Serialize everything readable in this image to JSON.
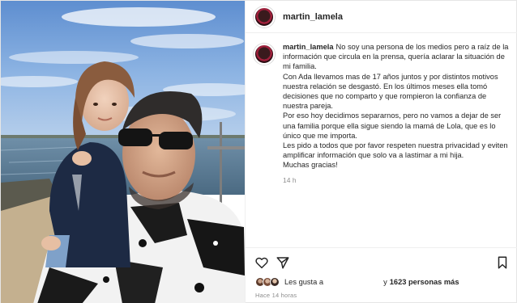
{
  "post": {
    "username": "martin_lamela",
    "caption": {
      "paragraphs": [
        "No soy una persona de los medios pero a raíz de la información que circula en la prensa, quería aclarar la situación de mi familia.",
        "Con Ada llevamos mas de 17 años juntos y por distintos motivos nuestra relación se desgastó. En los últimos meses ella tomó decisiones que no comparto y que rompieron la confianza de nuestra pareja.",
        "Por eso hoy decidimos separarnos, pero no vamos a dejar de ser una familia porque ella sigue siendo la mamá de Lola, que es lo único que me importa.",
        "Les pido a todos que por favor respeten nuestra privacidad y eviten amplificar información que solo va a lastimar a mi hija.",
        "Muchas gracias!"
      ],
      "relative_time": "14 h"
    },
    "likes": {
      "prefix": "Les gusta a",
      "suffix": "y",
      "count_text": "1623 personas más"
    },
    "absolute_time": "Hace 14 horas"
  },
  "icons": {
    "like": "heart-icon",
    "share": "paper-plane-icon",
    "save": "bookmark-icon"
  },
  "colors": {
    "text": "#262626",
    "muted": "#8e8e8e",
    "border": "#efefef"
  }
}
